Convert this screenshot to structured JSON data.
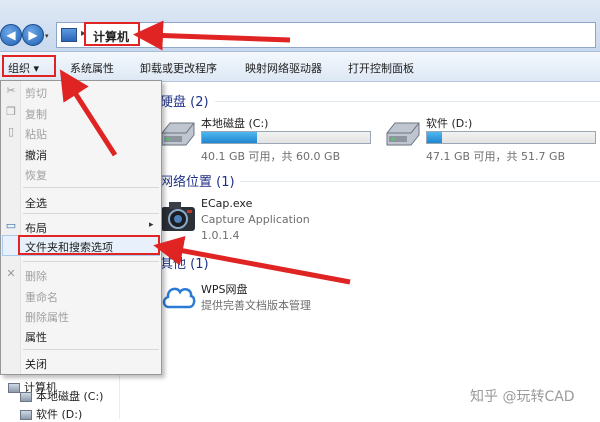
{
  "address_bar": {
    "back_label": "◀",
    "forward_label": "▶",
    "dropdown_label": "▾",
    "chevron": "▸",
    "path": "计算机"
  },
  "toolbar": {
    "organize": "组织 ▾",
    "system_properties": "系统属性",
    "uninstall": "卸载或更改程序",
    "map_drive": "映射网络驱动器",
    "control_panel": "打开控制面板"
  },
  "groups": {
    "hard_disks": "硬盘 (2)",
    "network_locations": "网络位置 (1)",
    "other": "其他 (1)"
  },
  "drives": [
    {
      "name": "本地磁盘 (C:)",
      "free": "40.1 GB 可用，共 60.0 GB",
      "used_fraction": 0.33
    },
    {
      "name": "软件 (D:)",
      "free": "47.1 GB 可用，共 51.7 GB",
      "used_fraction": 0.09
    }
  ],
  "network_app": {
    "name": "ECap.exe",
    "desc": "Capture Application",
    "version": "1.0.1.4"
  },
  "other_app": {
    "name": "WPS网盘",
    "desc": "提供完善文档版本管理"
  },
  "menu": {
    "cut": "剪切",
    "copy": "复制",
    "paste": "粘贴",
    "undo": "撤消",
    "redo": "恢复",
    "select_all": "全选",
    "layout": "布局",
    "layout_arrow": "▸",
    "folder_options": "文件夹和搜索选项",
    "delete": "删除",
    "rename": "重命名",
    "remove_props": "删除属性",
    "properties": "属性",
    "close": "关闭"
  },
  "nav": {
    "computer": "计算机",
    "c_drive": "本地磁盘 (C:)",
    "d_drive": "软件 (D:)"
  },
  "watermark": "知乎 @玩转CAD",
  "colors": {
    "accent_red": "#e02424",
    "group_header": "#1e3287",
    "drive_bar": "#1f86d0"
  }
}
